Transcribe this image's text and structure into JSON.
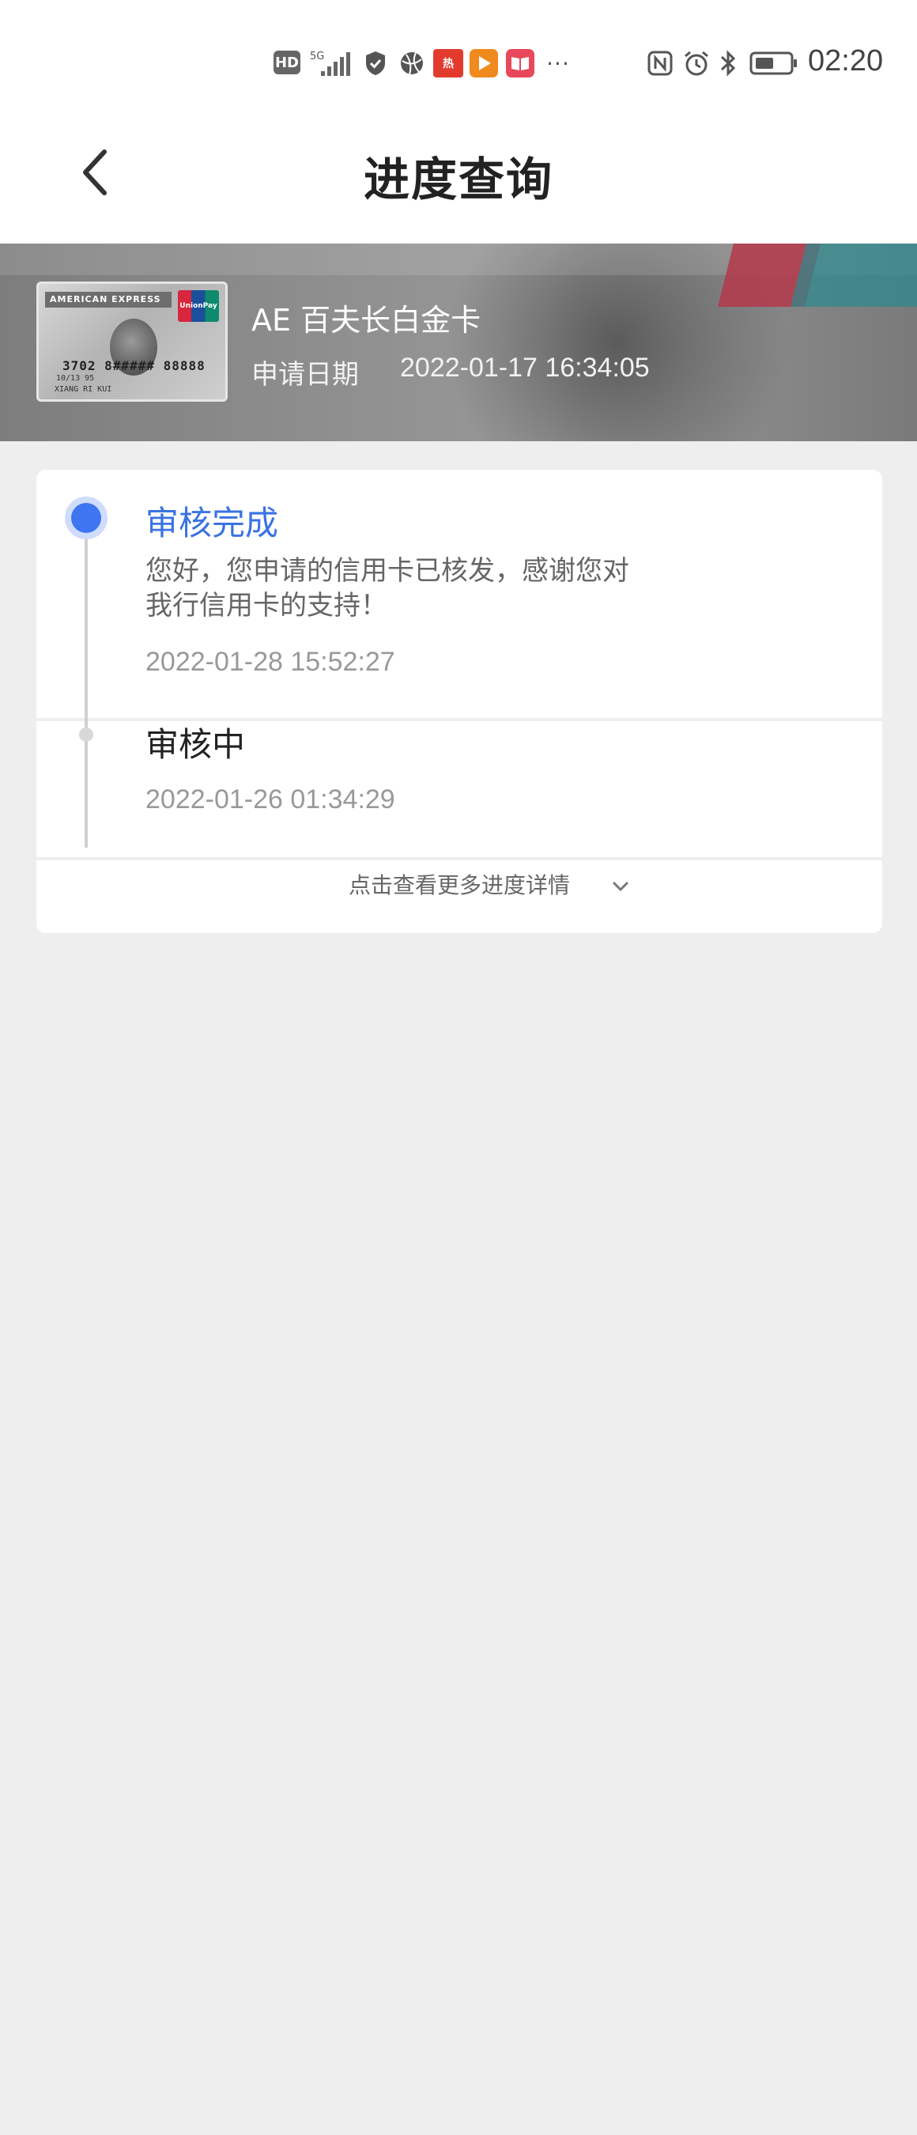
{
  "status_bar": {
    "time": "02:20",
    "network": "5G",
    "hd_badge": "HD",
    "overflow": "···",
    "icons": [
      "hd-icon",
      "signal-5g-icon",
      "shield-icon",
      "globe-icon",
      "app-icon",
      "video-app-icon",
      "book-app-icon",
      "more-icon",
      "nfc-icon",
      "alarm-icon",
      "bluetooth-icon",
      "battery-icon"
    ]
  },
  "header": {
    "title": "进度查询",
    "back_icon": "chevron-left-icon"
  },
  "card": {
    "name": "AE 百夫长白金卡",
    "apply_label": "申请日期",
    "apply_date": "2022-01-17 16:34:05",
    "thumbnail": {
      "brand_text": "AMERICAN EXPRESS",
      "unionpay_text": "UnionPay",
      "number": "3702 8##### 88888",
      "holder": "XIANG RI KUI",
      "valid": "10/13   95"
    }
  },
  "progress": {
    "steps": [
      {
        "title": "审核完成",
        "description": "您好，您申请的信用卡已核发，感谢您对我行信用卡的支持！",
        "time": "2022-01-28 15:52:27",
        "active": true
      },
      {
        "title": "审核中",
        "time": "2022-01-26 01:34:29",
        "active": false
      }
    ],
    "more_label": "点击查看更多进度详情",
    "more_icon": "chevron-down-icon"
  },
  "colors": {
    "accent": "#3e75f0",
    "active_text": "#3a73e2",
    "background": "#eeeeee"
  }
}
